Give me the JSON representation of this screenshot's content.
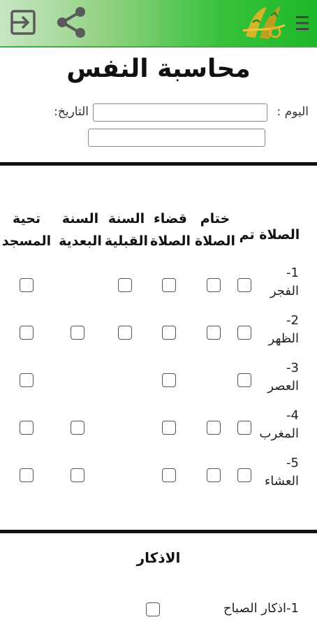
{
  "appbar": {
    "menu_icon": "hamburger-menu-icon",
    "logo_icon": "quran-calligraphy-logo",
    "share_icon": "share-icon",
    "exit_icon": "exit-icon",
    "colors": {
      "bar_start": "#c8e6c4",
      "bar_end": "#1fb82a"
    }
  },
  "page": {
    "title": "محاسبة النفس",
    "day_label": "اليوم :",
    "date_label": "التاريخ:",
    "day_value": "",
    "date_value": "",
    "extra_value": ""
  },
  "prayers": {
    "headers": [
      {
        "line1": "الصلاة تم",
        "line2": ""
      },
      {
        "line1": "ختام",
        "line2": "الصلاة"
      },
      {
        "line1": "قضاء",
        "line2": "الصلاة"
      },
      {
        "line1": "السنة",
        "line2": "القبلية"
      },
      {
        "line1": "السنة",
        "line2": "البعدية"
      },
      {
        "line1": "تحية",
        "line2": "المسجد"
      }
    ],
    "rows": [
      {
        "number": "1-",
        "name": "الفجر",
        "checkboxes": [
          true,
          true,
          true,
          true,
          false,
          true
        ]
      },
      {
        "number": "2-",
        "name": "الظهر",
        "checkboxes": [
          true,
          true,
          true,
          true,
          true,
          true
        ]
      },
      {
        "number": "3-",
        "name": "العصر",
        "checkboxes": [
          true,
          false,
          true,
          false,
          false,
          true
        ]
      },
      {
        "number": "4-",
        "name": "المغرب",
        "checkboxes": [
          true,
          true,
          true,
          false,
          true,
          true
        ]
      },
      {
        "number": "5-",
        "name": "العشاء",
        "checkboxes": [
          true,
          true,
          true,
          false,
          true,
          true
        ]
      }
    ]
  },
  "azkar": {
    "title": "الاذكار",
    "items": [
      {
        "label": "1-اذكار الصباح"
      }
    ]
  }
}
